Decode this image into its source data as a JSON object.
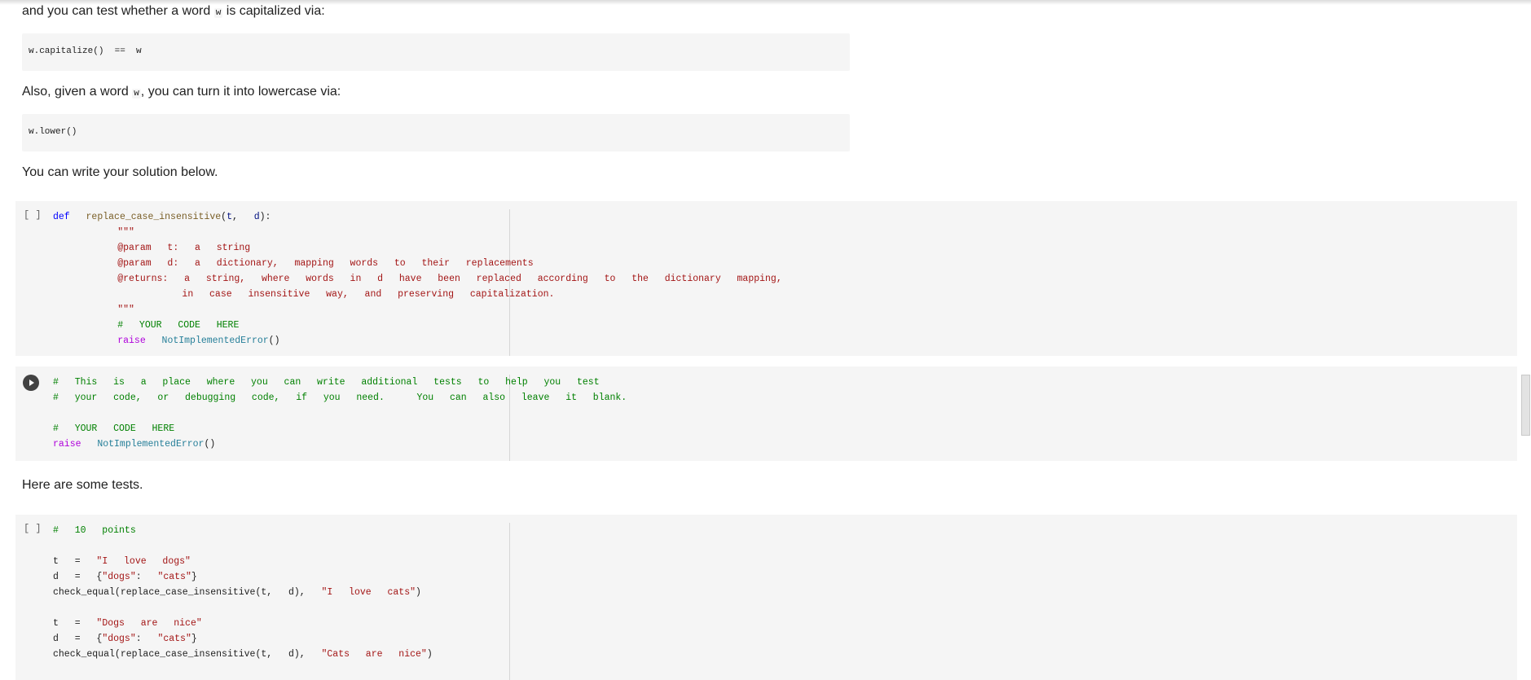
{
  "markdown": {
    "capitalized_intro": {
      "before": "and you can test whether a word ",
      "code": "w",
      "after": " is capitalized via:"
    },
    "capitalized_code": "w.capitalize()  ==  w",
    "lowercase_intro": {
      "before": "Also, given a word ",
      "code": "w",
      "after": ", you can turn it into lowercase via:"
    },
    "lowercase_code": "w.lower()",
    "solution_intro": "You can write your solution below.",
    "tests_intro": "Here are some tests."
  },
  "cells": {
    "solution": {
      "gutter": "[ ]",
      "def_kw": "def",
      "fn_name": "replace_case_insensitive",
      "param_t": "t",
      "param_d": "d",
      "docstring_open": "\"\"\"",
      "doc_lines": [
        "@param  t:  a  string",
        "@param  d:  a  dictionary,  mapping  words  to  their  replacements",
        "@returns:  a  string,  where  words  in  d  have  been  replaced  according  to  the  dictionary  mapping,",
        "        in  case  insensitive  way,  and  preserving  capitalization."
      ],
      "docstring_close": "\"\"\"",
      "comment": "#  YOUR  CODE  HERE",
      "raise_kw": "raise",
      "error_class": "NotImplementedError"
    },
    "scratch": {
      "run_button": "run-cell",
      "comment_lines": [
        "#  This  is  a  place  where  you  can  write  additional  tests  to  help  you  test",
        "#  your  code,  or  debugging  code,  if  you  need.    You  can  also  leave  it  blank."
      ],
      "code_comment": "#  YOUR  CODE  HERE",
      "raise_kw": "raise",
      "error_class": "NotImplementedError"
    },
    "tests": {
      "gutter": "[ ]",
      "comment": "#  10  points",
      "test1": {
        "t_value": "\"I  love  dogs\"",
        "d_key": "\"dogs\"",
        "d_val": "\"cats\"",
        "expected": "\"I  love  cats\""
      },
      "test2": {
        "t_value": "\"Dogs  are  nice\"",
        "d_key": "\"dogs\"",
        "d_val": "\"cats\"",
        "expected": "\"Cats  are  nice\""
      },
      "check_fn": "check_equal",
      "call_fn": "replace_case_insensitive"
    }
  },
  "colors": {
    "cell_bg": "#f5f5f5",
    "keyword": "#0000ff",
    "function": "#795e26",
    "param": "#001080",
    "string": "#a31515",
    "comment": "#008000",
    "raise": "#af00db",
    "class": "#267f99"
  }
}
